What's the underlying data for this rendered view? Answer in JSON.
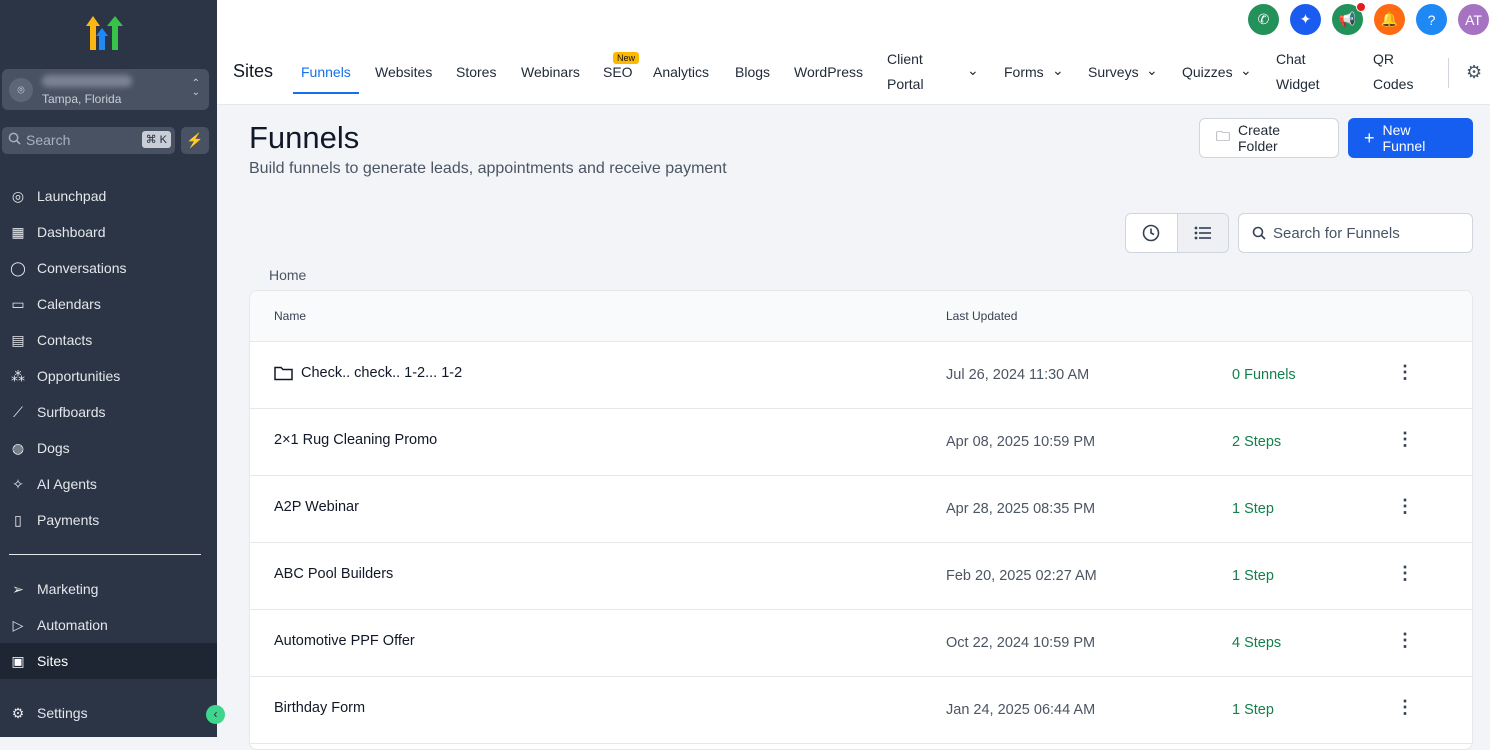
{
  "sidebar": {
    "location": "Tampa, Florida",
    "search_placeholder": "Search",
    "shortcut": "⌘ K",
    "items": [
      {
        "label": "Launchpad",
        "icon": "rocket-icon"
      },
      {
        "label": "Dashboard",
        "icon": "grid-icon"
      },
      {
        "label": "Conversations",
        "icon": "chat-icon"
      },
      {
        "label": "Calendars",
        "icon": "calendar-icon"
      },
      {
        "label": "Contacts",
        "icon": "contacts-icon"
      },
      {
        "label": "Opportunities",
        "icon": "network-icon"
      },
      {
        "label": "Surfboards",
        "icon": "surfboard-icon"
      },
      {
        "label": "Dogs",
        "icon": "dog-icon"
      },
      {
        "label": "AI Agents",
        "icon": "sparkle-icon"
      },
      {
        "label": "Payments",
        "icon": "receipt-icon"
      }
    ],
    "bottom_items": [
      {
        "label": "Marketing",
        "icon": "send-icon"
      },
      {
        "label": "Automation",
        "icon": "play-icon"
      },
      {
        "label": "Sites",
        "icon": "globe-icon"
      }
    ],
    "settings": "Settings"
  },
  "header": {
    "section": "Sites",
    "tabs": [
      "Funnels",
      "Websites",
      "Stores",
      "Webinars",
      "SEO",
      "Analytics",
      "Blogs",
      "WordPress",
      "Client Portal",
      "Forms",
      "Surveys",
      "Quizzes",
      "Chat Widget",
      "QR Codes"
    ],
    "new_badge": "New",
    "avatar": "AT",
    "colors": {
      "phone": "#22915a",
      "ai": "#1b5cf0",
      "announce": "#22915a",
      "bell": "#ff6a13",
      "help": "#1e88f5",
      "avatar": "#a673c3"
    }
  },
  "page": {
    "title": "Funnels",
    "subtitle": "Build funnels to generate leads, appointments and receive payment",
    "create_folder": "Create Folder",
    "new_funnel": "New Funnel",
    "search_placeholder": "Search for Funnels",
    "breadcrumb": "Home"
  },
  "table": {
    "headers": [
      "Name",
      "Last Updated"
    ],
    "rows": [
      {
        "name": "Check.. check.. 1-2... 1-2",
        "date": "Jul 26, 2024 11:30 AM",
        "count": "0 Funnels",
        "folder": true
      },
      {
        "name": "2×1 Rug Cleaning Promo",
        "date": "Apr 08, 2025 10:59 PM",
        "count": "2 Steps"
      },
      {
        "name": "A2P Webinar",
        "date": "Apr 28, 2025 08:35 PM",
        "count": "1 Step"
      },
      {
        "name": "ABC Pool Builders",
        "date": "Feb 20, 2025 02:27 AM",
        "count": "1 Step"
      },
      {
        "name": "Automotive PPF Offer",
        "date": "Oct 22, 2024 10:59 PM",
        "count": "4 Steps"
      },
      {
        "name": "Birthday Form",
        "date": "Jan 24, 2025 06:44 AM",
        "count": "1 Step"
      }
    ]
  }
}
